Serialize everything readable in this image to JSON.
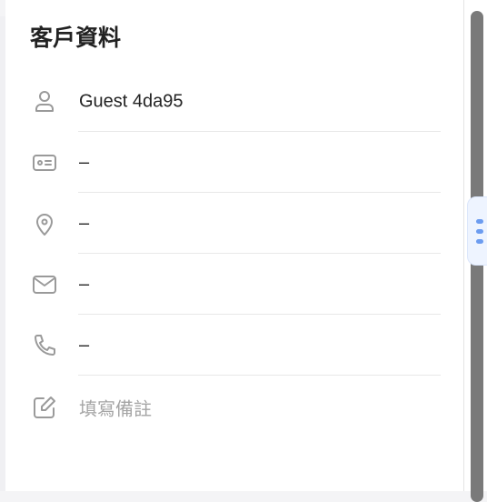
{
  "title": "客戶資料",
  "rows": [
    {
      "icon": "user-icon",
      "value": "Guest 4da95"
    },
    {
      "icon": "id-card-icon",
      "value": "–"
    },
    {
      "icon": "location-pin-icon",
      "value": "–"
    },
    {
      "icon": "mail-icon",
      "value": "–"
    },
    {
      "icon": "phone-icon",
      "value": "–"
    },
    {
      "icon": "edit-note-icon",
      "placeholder": "填寫備註"
    }
  ],
  "colors": {
    "accent": "#6c9cf0",
    "scrollbar": "#7a7a7a"
  }
}
